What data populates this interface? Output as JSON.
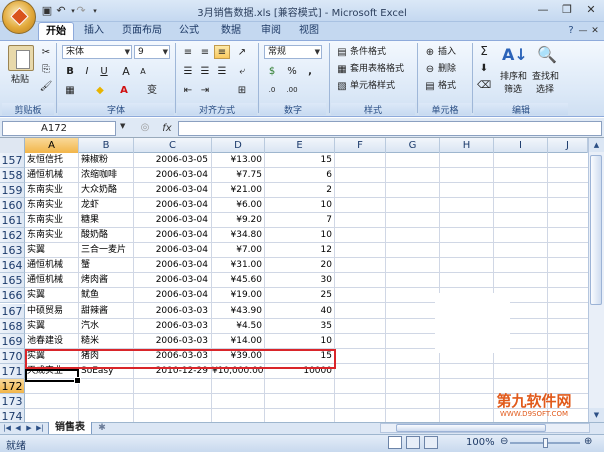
{
  "window": {
    "title": "3月销售数据.xls [兼容模式] - Microsoft Excel"
  },
  "ribbon": {
    "tabs": [
      "开始",
      "插入",
      "页面布局",
      "公式",
      "数据",
      "审阅",
      "视图"
    ],
    "clipboard": {
      "paste": "粘贴",
      "group": "剪贴板"
    },
    "font": {
      "name": "宋体",
      "size": "9",
      "group": "字体"
    },
    "alignment": {
      "group": "对齐方式"
    },
    "number": {
      "format": "常规",
      "group": "数字"
    },
    "styles": {
      "cond": "条件格式",
      "table": "套用表格格式",
      "cell": "单元格样式",
      "group": "样式"
    },
    "cells": {
      "insert": "插入",
      "delete": "删除",
      "format": "格式",
      "group": "单元格"
    },
    "editing": {
      "sort": "排序和",
      "sort2": "筛选",
      "find": "查找和",
      "find2": "选择",
      "group": "编辑"
    }
  },
  "formula_bar": {
    "name_box": "A172",
    "fx": "fx",
    "value": ""
  },
  "columns": [
    "A",
    "B",
    "C",
    "D",
    "E",
    "F",
    "G",
    "H",
    "I",
    "J"
  ],
  "rows": [
    {
      "n": "157",
      "a": "友恒信托",
      "b": "辣椒粉",
      "c": "2006-03-05",
      "d": "¥13.00",
      "e": "15"
    },
    {
      "n": "158",
      "a": "通恒机械",
      "b": "浓缩咖啡",
      "c": "2006-03-04",
      "d": "¥7.75",
      "e": "6"
    },
    {
      "n": "159",
      "a": "东南实业",
      "b": "大众奶酪",
      "c": "2006-03-04",
      "d": "¥21.00",
      "e": "2"
    },
    {
      "n": "160",
      "a": "东南实业",
      "b": "龙虾",
      "c": "2006-03-04",
      "d": "¥6.00",
      "e": "10"
    },
    {
      "n": "161",
      "a": "东南实业",
      "b": "糖果",
      "c": "2006-03-04",
      "d": "¥9.20",
      "e": "7"
    },
    {
      "n": "162",
      "a": "东南实业",
      "b": "酸奶酪",
      "c": "2006-03-04",
      "d": "¥34.80",
      "e": "10"
    },
    {
      "n": "163",
      "a": "实翼",
      "b": "三合一麦片",
      "c": "2006-03-04",
      "d": "¥7.00",
      "e": "12"
    },
    {
      "n": "164",
      "a": "通恒机械",
      "b": "蟹",
      "c": "2006-03-04",
      "d": "¥31.00",
      "e": "20"
    },
    {
      "n": "165",
      "a": "通恒机械",
      "b": "烤肉酱",
      "c": "2006-03-04",
      "d": "¥45.60",
      "e": "30"
    },
    {
      "n": "166",
      "a": "实翼",
      "b": "鱿鱼",
      "c": "2006-03-04",
      "d": "¥19.00",
      "e": "25"
    },
    {
      "n": "167",
      "a": "中硕贸易",
      "b": "甜辣酱",
      "c": "2006-03-03",
      "d": "¥43.90",
      "e": "40"
    },
    {
      "n": "168",
      "a": "实翼",
      "b": "汽水",
      "c": "2006-03-03",
      "d": "¥4.50",
      "e": "35"
    },
    {
      "n": "169",
      "a": "池春建设",
      "b": "糙米",
      "c": "2006-03-03",
      "d": "¥14.00",
      "e": "10"
    },
    {
      "n": "170",
      "a": "实翼",
      "b": "猪肉",
      "c": "2006-03-03",
      "d": "¥39.00",
      "e": "15"
    },
    {
      "n": "171",
      "a": "天成实业",
      "b": "SoEasy",
      "c": "2010-12-29",
      "d": "¥10,000.00",
      "e": "10000"
    },
    {
      "n": "172",
      "a": "",
      "b": "",
      "c": "",
      "d": "",
      "e": ""
    },
    {
      "n": "173",
      "a": "",
      "b": "",
      "c": "",
      "d": "",
      "e": ""
    },
    {
      "n": "174",
      "a": "",
      "b": "",
      "c": "",
      "d": "",
      "e": ""
    },
    {
      "n": "175",
      "a": "",
      "b": "",
      "c": "",
      "d": "",
      "e": ""
    }
  ],
  "sheet_tab": "销售表",
  "status": {
    "ready": "就绪",
    "zoom": "100%"
  },
  "watermark": {
    "text": "第九软件网",
    "url": "WWW.D9SOFT.COM"
  }
}
